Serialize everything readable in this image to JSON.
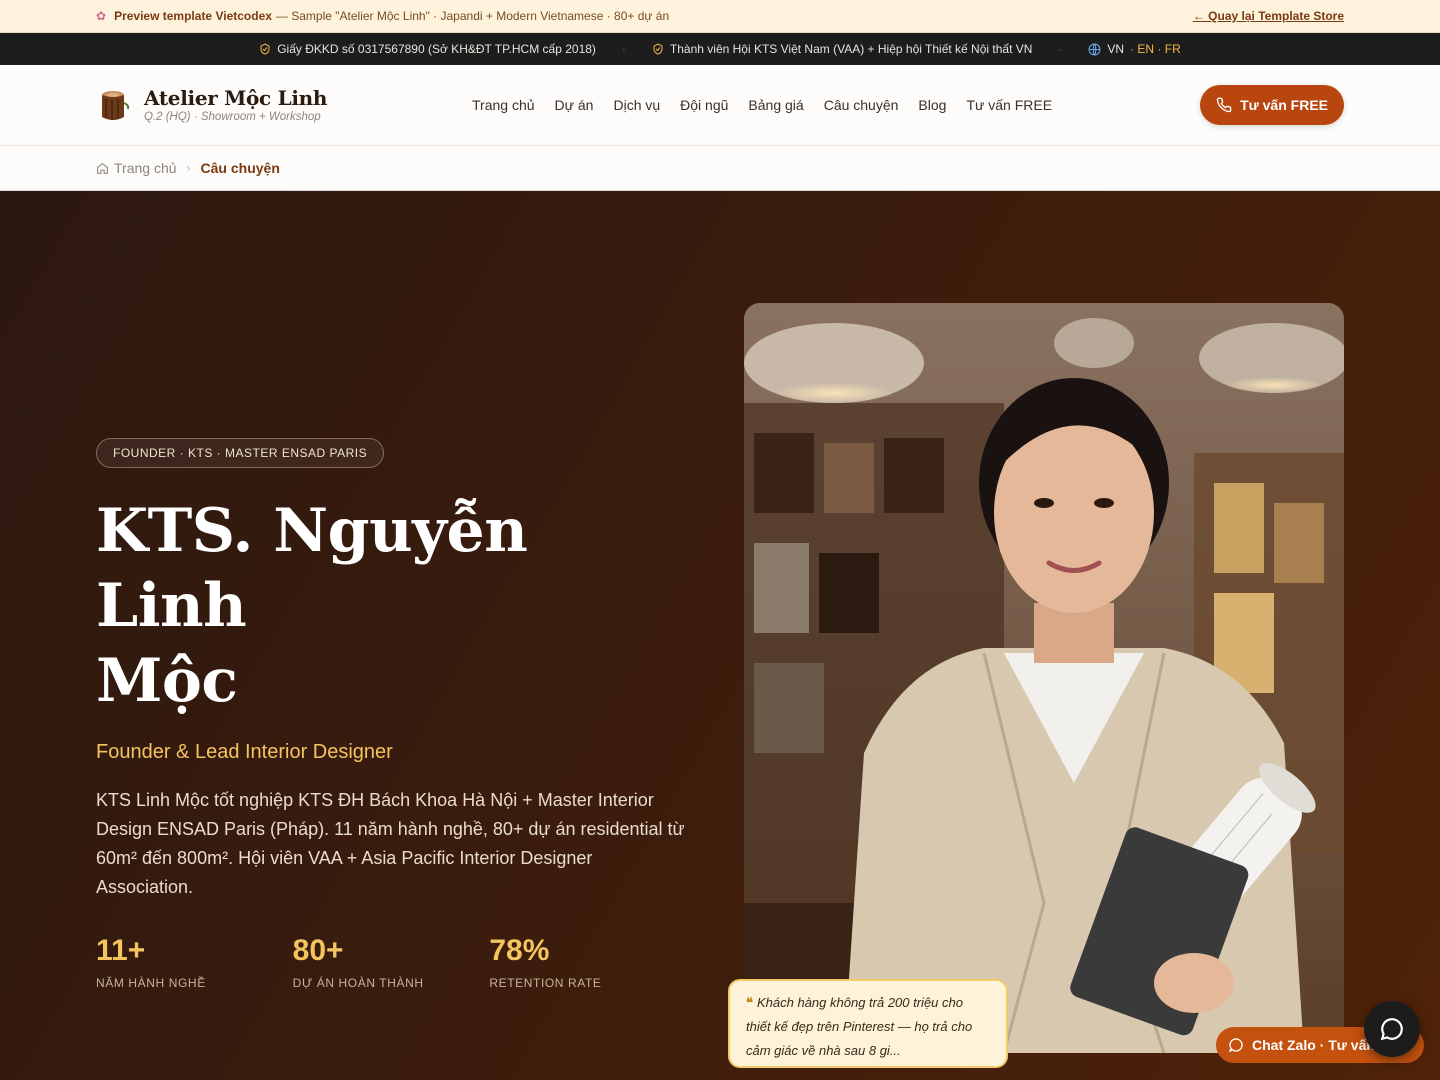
{
  "preview": {
    "title": "Preview template Vietcodex",
    "desc": "— Sample \"Atelier Mộc Linh\" · Japandi + Modern Vietnamese · 80+ dự án",
    "back": "← Quay lại Template Store"
  },
  "trust": {
    "license": "Giấy ĐKKD số 0317567890 (Sở KH&ĐT TP.HCM cấp 2018)",
    "member": "Thành viên Hội KTS Việt Nam (VAA) + Hiệp hội Thiết kế Nội thất VN",
    "lang_active": "VN",
    "lang_others": "· EN · FR"
  },
  "brand": {
    "name": "Atelier Mộc Linh",
    "sub": "Q.2 (HQ) · Showroom + Workshop"
  },
  "nav": [
    "Trang chủ",
    "Dự án",
    "Dịch vụ",
    "Đội ngũ",
    "Bảng giá",
    "Câu chuyện",
    "Blog",
    "Tư vấn FREE"
  ],
  "cta": "Tư vấn FREE",
  "breadcrumb": {
    "home": "Trang chủ",
    "current": "Câu chuyện"
  },
  "hero": {
    "badge": "FOUNDER · KTS · MASTER ENSAD PARIS",
    "title_line1": "KTS. Nguyễn Linh",
    "title_line2": "Mộc",
    "role": "Founder & Lead Interior Designer",
    "desc": "KTS Linh Mộc tốt nghiệp KTS ĐH Bách Khoa Hà Nội + Master Interior Design ENSAD Paris (Pháp). 11 năm hành nghề, 80+ dự án residential từ 60m² đến 800m². Hội viên VAA + Asia Pacific Interior Designer Association.",
    "stats": [
      {
        "num": "11+",
        "label": "NĂM HÀNH NGHỀ"
      },
      {
        "num": "80+",
        "label": "DỰ ÁN HOÀN THÀNH"
      },
      {
        "num": "78%",
        "label": "RETENTION RATE"
      }
    ],
    "quote": "Khách hàng không trả 200 triệu cho thiết kế đẹp trên Pinterest — họ trả cho cảm giác về nhà sau 8 gi..."
  },
  "chat": {
    "zalo": "Chat Zalo · Tư vấn"
  },
  "colors": {
    "accent": "#b8460e",
    "gold": "#f4c45e",
    "hero_bg": "#3a1c0d"
  }
}
